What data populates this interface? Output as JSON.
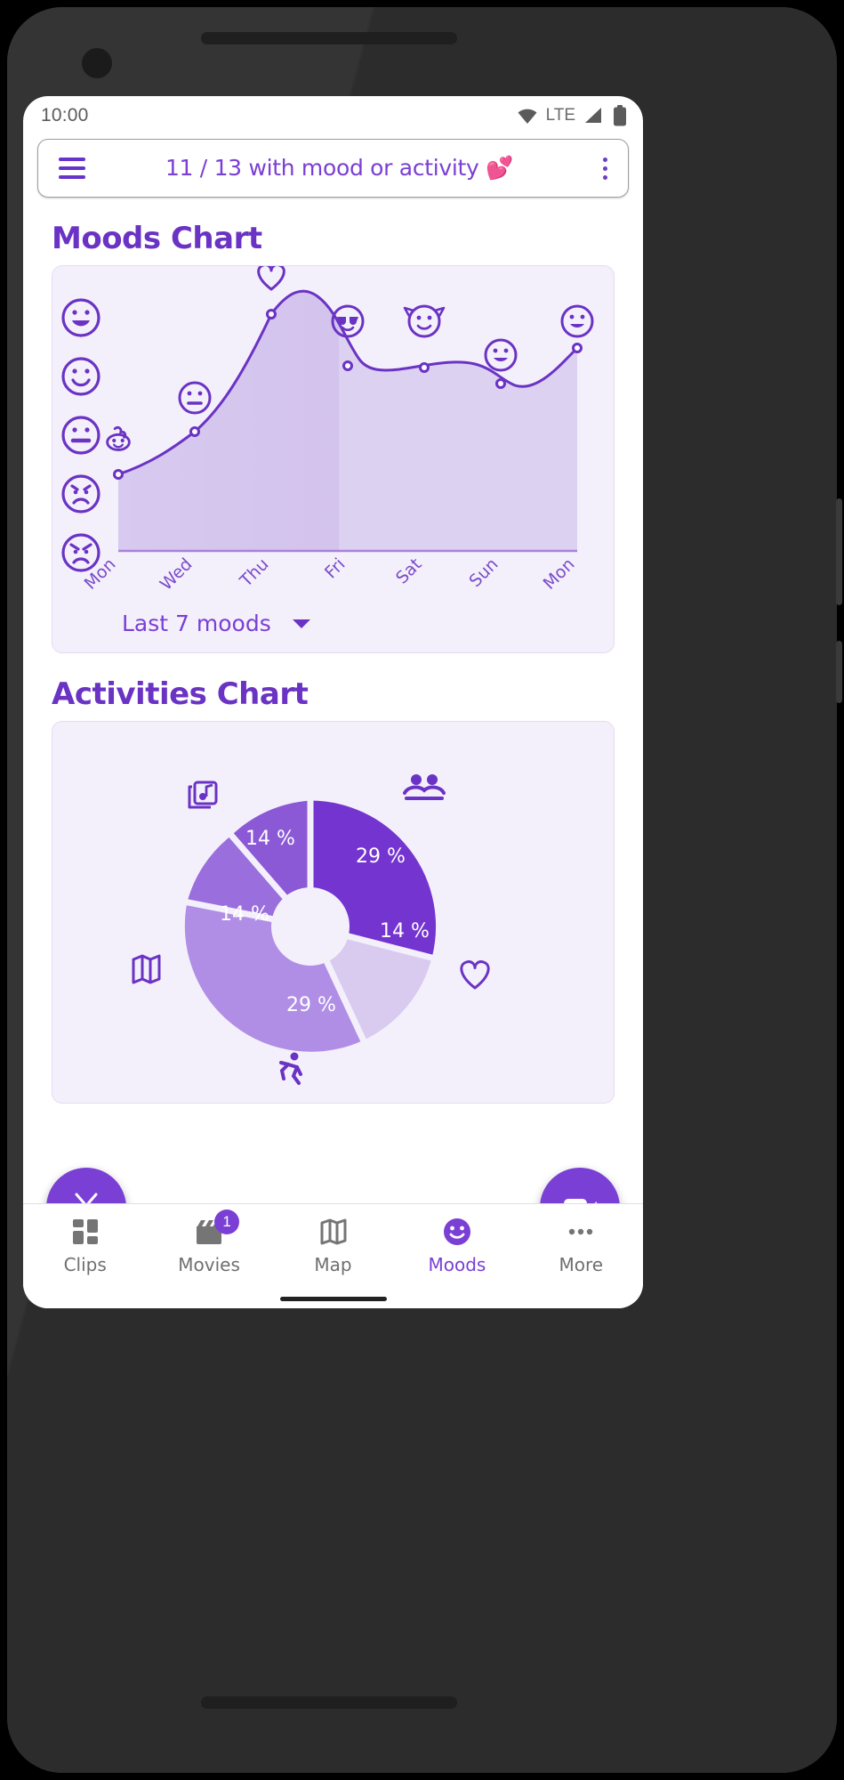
{
  "status_bar": {
    "time": "10:00",
    "network_label": "LTE",
    "icons": [
      "wifi-icon",
      "signal-icon",
      "battery-icon"
    ]
  },
  "app_bar": {
    "menu_icon": "hamburger-menu-icon",
    "title": "11 / 13 with mood or activity 💕",
    "overflow_icon": "three-dot-menu-icon"
  },
  "moods_section": {
    "heading": "Moods Chart",
    "range_selector": {
      "label": "Last 7 moods",
      "caret_icon": "chevron-down-icon"
    }
  },
  "activities_section": {
    "heading": "Activities Chart"
  },
  "fabs": [
    {
      "name": "cut-clip-fab",
      "icon": "scissors-icon"
    },
    {
      "name": "record-video-fab",
      "icon": "video-camera-icon"
    }
  ],
  "bottom_nav": {
    "items": [
      {
        "label": "Clips",
        "icon": "grid-dashboard-icon",
        "active": false,
        "badge": ""
      },
      {
        "label": "Movies",
        "icon": "movie-clapper-icon",
        "active": false,
        "badge": "1"
      },
      {
        "label": "Map",
        "icon": "map-icon",
        "active": false,
        "badge": ""
      },
      {
        "label": "Moods",
        "icon": "smiley-face-icon",
        "active": true,
        "badge": ""
      },
      {
        "label": "More",
        "icon": "ellipsis-icon",
        "active": false,
        "badge": ""
      }
    ]
  },
  "colors": {
    "primary": "#7a3fd4",
    "primary_dark": "#6a33c4",
    "card_bg": "#f4f0fb",
    "area_fill": "#d6c7ee",
    "pie_1": "#7434d0",
    "pie_2": "#8b59d6",
    "pie_3": "#9a6fdd",
    "pie_4": "#b08ee6",
    "pie_5": "#d9cbf0",
    "heart_pink": "#f472a6"
  },
  "chart_data": [
    {
      "type": "area",
      "title": "Moods Chart",
      "xlabel": "",
      "ylabel": "",
      "x": [
        "Mon",
        "Wed",
        "Thu",
        "Fri",
        "Sat",
        "Sun",
        "Mon"
      ],
      "categories": [
        "Mon",
        "Wed",
        "Thu",
        "Fri",
        "Sat",
        "Sun",
        "Mon"
      ],
      "y_tick_icons": [
        "very-happy-face-icon",
        "happy-face-icon",
        "neutral-face-icon",
        "sad-face-icon",
        "very-sad-face-icon"
      ],
      "ylim": [
        1,
        5
      ],
      "values": [
        2,
        3,
        5,
        4,
        4,
        3.5,
        4.3
      ],
      "point_markers": [
        "poop-icon",
        "neutral-face-icon",
        "heart-icon",
        "sunglasses-face-icon",
        "devil-face-icon",
        "smile-face-icon",
        "smile-face-icon"
      ],
      "grid": false,
      "legend": "none",
      "x_tick_rotation_deg": -45
    },
    {
      "type": "pie",
      "title": "Activities Chart",
      "labels": [
        "People",
        "Heart",
        "Running",
        "Map",
        "Music"
      ],
      "label_icons": [
        "people-icon",
        "heart-icon",
        "running-icon",
        "map-icon",
        "music-note-icon"
      ],
      "values": [
        29,
        14,
        29,
        14,
        14
      ],
      "value_labels": [
        "29 %",
        "14 %",
        "29 %",
        "14 %",
        "14 %"
      ],
      "donut": true,
      "legend": "icons-around-chart",
      "colors": [
        "#7434d0",
        "#d9cbf0",
        "#b08ee6",
        "#9a6fdd",
        "#8b59d6"
      ]
    }
  ]
}
